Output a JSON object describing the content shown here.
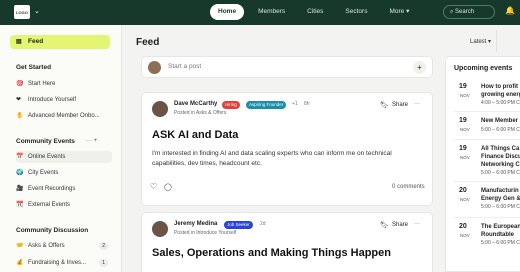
{
  "logo": {
    "text": "LOGO"
  },
  "nav": {
    "items": [
      "Home",
      "Members",
      "Cities",
      "Sectors",
      "More"
    ],
    "active": "Home",
    "more_chevron": "▾",
    "search": "Search"
  },
  "sidebar": {
    "feed": "Feed",
    "get_started": {
      "title": "Get Started",
      "items": [
        "Start Here",
        "Introduce Yourself",
        "Advanced Member Onbo..."
      ]
    },
    "community_events": {
      "title": "Community Events",
      "actions": "··· +",
      "items": [
        "Online Events",
        "City Events",
        "Event Recordings",
        "External Events"
      ]
    },
    "community_discussion": {
      "title": "Community Discussion",
      "items": [
        {
          "label": "Asks & Offers",
          "count": "2"
        },
        {
          "label": "Fundraising & Inves...",
          "count": "1"
        }
      ]
    }
  },
  "main": {
    "title": "Feed",
    "sort": "Latest ▾",
    "start_post": "Start a post",
    "posts": [
      {
        "author": "Dave McCarthy",
        "tags": [
          {
            "label": "Hiring",
            "color": "#e0413b"
          },
          {
            "label": "Aspiring Founder",
            "color": "#1b8fa8"
          }
        ],
        "extra": "+1",
        "time": "8h",
        "posted_in": "Posted in Asks & Offers",
        "share": "Share",
        "title": "ASK AI and Data",
        "body": "I'm interested in finding AI and data scaling experts who can inform me on technical capabilities, dev times, headcount etc.",
        "comments": "0 comments"
      },
      {
        "author": "Jeremy Medina",
        "tags": [
          {
            "label": "Job Seeker",
            "color": "#2a44d6"
          }
        ],
        "extra": "",
        "time": "2d",
        "posted_in": "Posted in Introduce Yourself",
        "share": "Share",
        "title": "Sales, Operations and Making Things Happen"
      }
    ]
  },
  "events": {
    "title": "Upcoming events",
    "items": [
      {
        "day": "19",
        "mon": "NOV",
        "title": "How to profit growing energ",
        "time": "4:00 – 5:00 PM C"
      },
      {
        "day": "19",
        "mon": "NOV",
        "title": "New Member",
        "time": "5:00 – 6:00 PM C"
      },
      {
        "day": "19",
        "mon": "NOV",
        "title": "All Things Ca Finance Discu Networking C",
        "time": "5:00 – 6:00 PM C"
      },
      {
        "day": "20",
        "mon": "NOV",
        "title": "Manufacturin Energy Gen &",
        "time": "5:00 – 6:00 PM C"
      },
      {
        "day": "20",
        "mon": "NOV",
        "title": "The European Roundtable",
        "time": "5:00 – 6:00 PM C"
      }
    ]
  }
}
